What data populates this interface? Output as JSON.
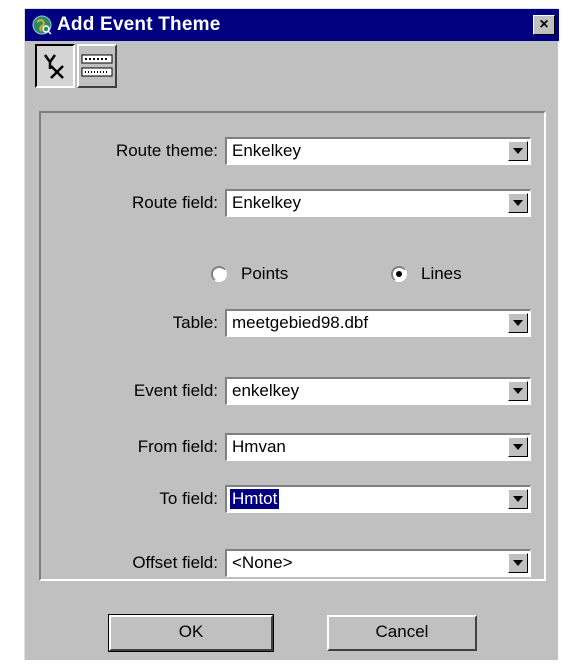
{
  "window": {
    "title": "Add Event Theme",
    "close_label": "×"
  },
  "toolbar": {
    "tools": [
      {
        "name": "xy-event-tool",
        "glyph": "Y×"
      },
      {
        "name": "route-event-tool",
        "glyph": "ruler"
      }
    ]
  },
  "form": {
    "route_theme": {
      "label": "Route theme:",
      "value": "Enkelkey"
    },
    "route_field": {
      "label": "Route field:",
      "value": "Enkelkey"
    },
    "geometry": {
      "options": [
        {
          "label": "Points",
          "selected": false
        },
        {
          "label": "Lines",
          "selected": true
        }
      ]
    },
    "table": {
      "label": "Table:",
      "value": "meetgebied98.dbf"
    },
    "event_field": {
      "label": "Event field:",
      "value": "enkelkey"
    },
    "from_field": {
      "label": "From field:",
      "value": "Hmvan"
    },
    "to_field": {
      "label": "To field:",
      "value": "Hmtot"
    },
    "offset_field": {
      "label": "Offset field:",
      "value": "<None>"
    }
  },
  "buttons": {
    "ok": "OK",
    "cancel": "Cancel"
  },
  "colors": {
    "titlebar": "#000080",
    "face": "#c0c0c0"
  }
}
